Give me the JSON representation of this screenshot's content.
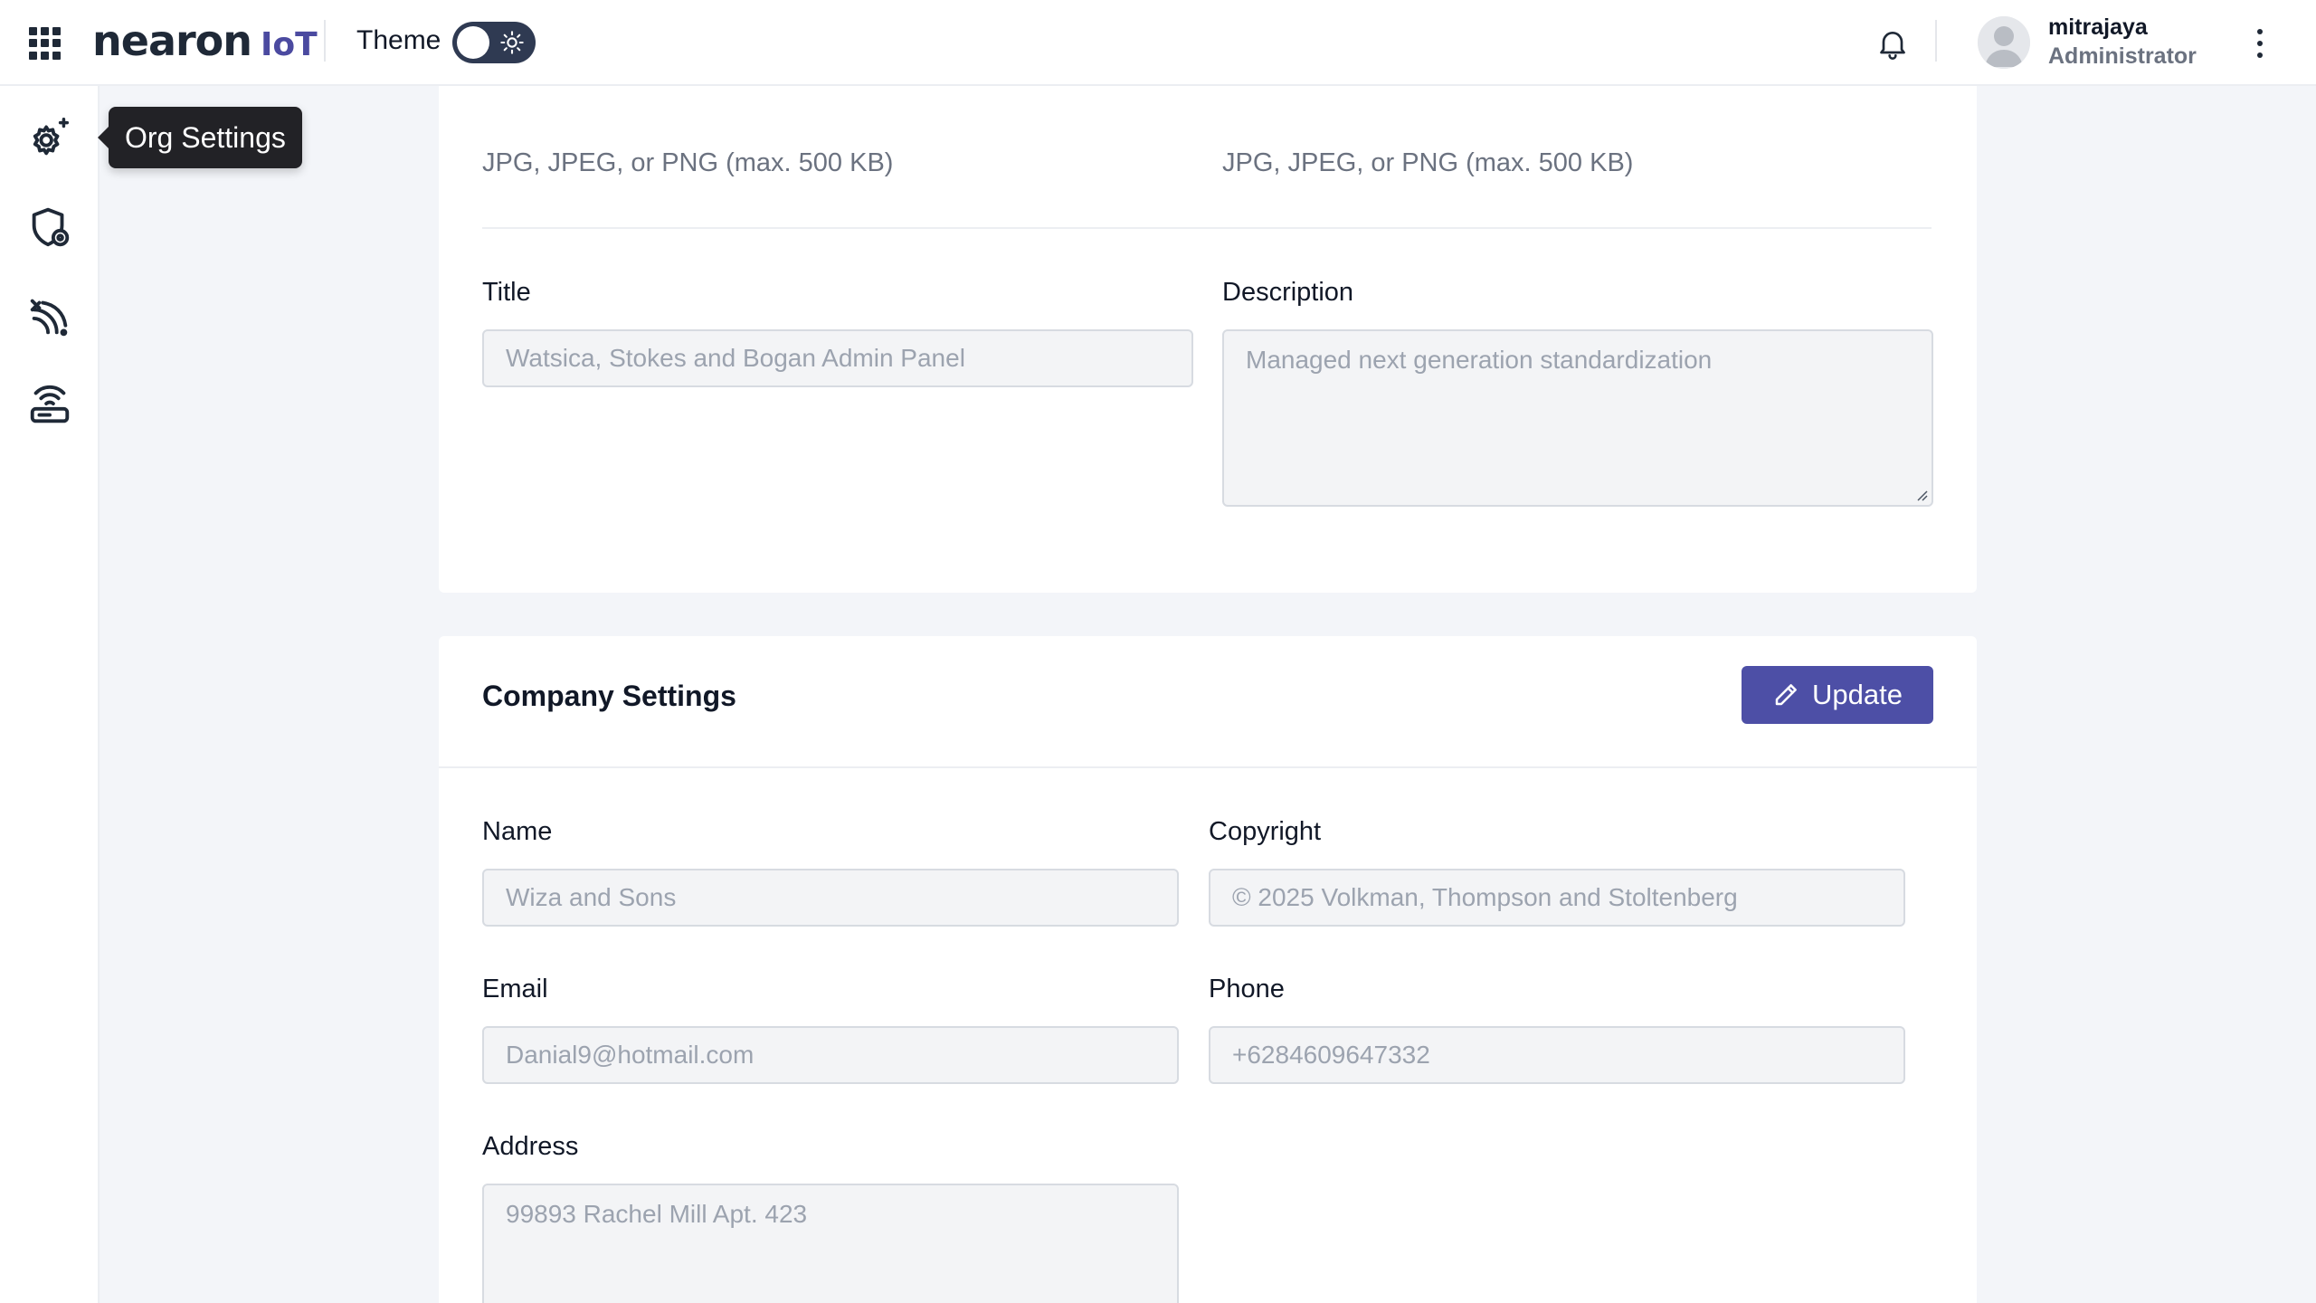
{
  "header": {
    "brand": "nearon",
    "brand_suffix": "IoT",
    "theme_label": "Theme",
    "user": {
      "name": "mitrajaya",
      "role": "Administrator"
    }
  },
  "sidebar": {
    "tooltip": "Org Settings",
    "items": [
      {
        "icon": "org-settings-gear-icon"
      },
      {
        "icon": "shield-settings-icon"
      },
      {
        "icon": "signal-waves-icon"
      },
      {
        "icon": "router-wifi-icon"
      }
    ]
  },
  "branding": {
    "logo_hint": "JPG, JPEG, or PNG (max. 500 KB)",
    "favicon_hint": "JPG, JPEG, or PNG (max. 500 KB)",
    "title_label": "Title",
    "title_placeholder": "Watsica, Stokes and Bogan Admin Panel",
    "description_label": "Description",
    "description_placeholder": "Managed next generation standardization"
  },
  "company": {
    "title": "Company Settings",
    "update_label": "Update",
    "name_label": "Name",
    "name_placeholder": "Wiza and Sons",
    "copyright_label": "Copyright",
    "copyright_placeholder": "© 2025 Volkman, Thompson and Stoltenberg",
    "email_label": "Email",
    "email_placeholder": "Danial9@hotmail.com",
    "phone_label": "Phone",
    "phone_placeholder": "+6284609647332",
    "address_label": "Address",
    "address_placeholder": "99893 Rachel Mill Apt. 423"
  },
  "colors": {
    "accent": "#4d4fa6",
    "dark": "#1e2639",
    "tooltip_bg": "#222226"
  }
}
